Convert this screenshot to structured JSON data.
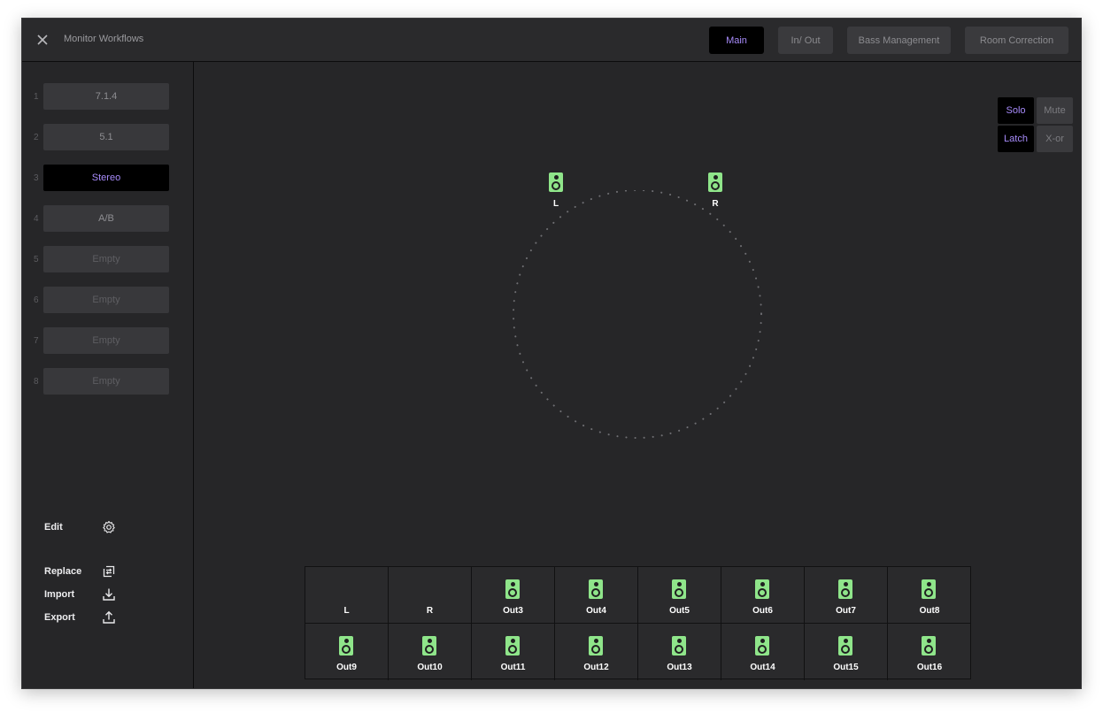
{
  "window": {
    "title": "Monitor Workflows"
  },
  "tabs": [
    {
      "label": "Main",
      "active": true
    },
    {
      "label": "In/ Out",
      "active": false
    },
    {
      "label": "Bass Management",
      "active": false
    },
    {
      "label": "Room Correction",
      "active": false
    }
  ],
  "sidebar": {
    "slots": [
      {
        "num": "1",
        "label": "7.1.4",
        "state": "filled"
      },
      {
        "num": "2",
        "label": "5.1",
        "state": "filled"
      },
      {
        "num": "3",
        "label": "Stereo",
        "state": "selected"
      },
      {
        "num": "4",
        "label": "A/B",
        "state": "filled"
      },
      {
        "num": "5",
        "label": "Empty",
        "state": "empty"
      },
      {
        "num": "6",
        "label": "Empty",
        "state": "empty"
      },
      {
        "num": "7",
        "label": "Empty",
        "state": "empty"
      },
      {
        "num": "8",
        "label": "Empty",
        "state": "empty"
      }
    ],
    "actions": {
      "edit": "Edit",
      "replace": "Replace",
      "import": "Import",
      "export": "Export"
    }
  },
  "modes": {
    "solo": "Solo",
    "mute": "Mute",
    "latch": "Latch",
    "xor": "X-or"
  },
  "speakers": {
    "left": "L",
    "right": "R"
  },
  "outputs": [
    {
      "label": "L",
      "speaker": false
    },
    {
      "label": "R",
      "speaker": false
    },
    {
      "label": "Out3",
      "speaker": true
    },
    {
      "label": "Out4",
      "speaker": true
    },
    {
      "label": "Out5",
      "speaker": true
    },
    {
      "label": "Out6",
      "speaker": true
    },
    {
      "label": "Out7",
      "speaker": true
    },
    {
      "label": "Out8",
      "speaker": true
    },
    {
      "label": "Out9",
      "speaker": true
    },
    {
      "label": "Out10",
      "speaker": true
    },
    {
      "label": "Out11",
      "speaker": true
    },
    {
      "label": "Out12",
      "speaker": true
    },
    {
      "label": "Out13",
      "speaker": true
    },
    {
      "label": "Out14",
      "speaker": true
    },
    {
      "label": "Out15",
      "speaker": true
    },
    {
      "label": "Out16",
      "speaker": true
    }
  ],
  "colors": {
    "accent": "#a78bfa",
    "speaker": "#8fe58a",
    "background": "#262628"
  }
}
